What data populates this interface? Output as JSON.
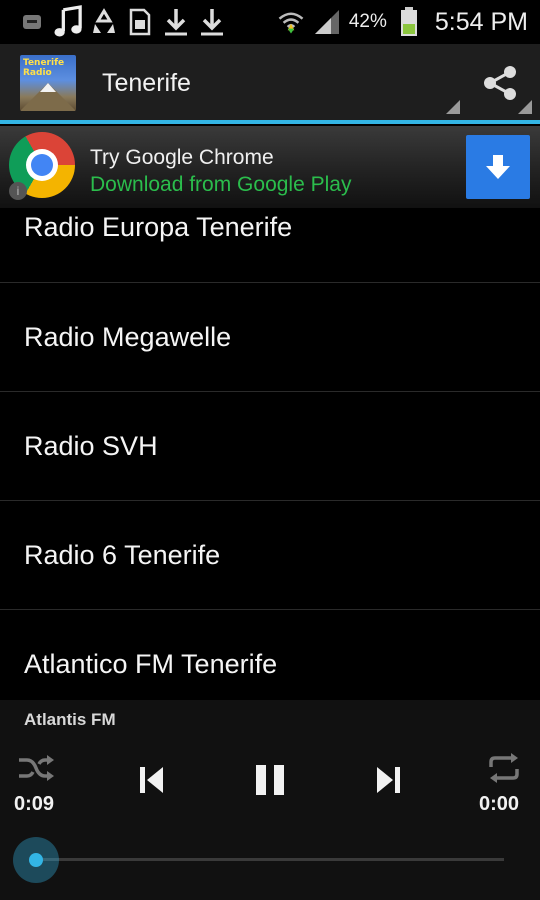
{
  "status_bar": {
    "battery_percent": "42%",
    "time": "5:54 PM",
    "icons": [
      "notification-icon",
      "music-note-icon",
      "recycle-icon",
      "sd-card-icon",
      "download-icon",
      "download-icon",
      "wifi-icon",
      "signal-icon",
      "battery-icon"
    ]
  },
  "action_bar": {
    "app_icon_text": "Tenerife Radio",
    "title": "Tenerife",
    "share_icon": "share-icon"
  },
  "ad": {
    "title": "Try Google Chrome",
    "subtitle": "Download from Google Play",
    "button_icon": "download-arrow-icon"
  },
  "stations": [
    {
      "name": "Radio Europa Tenerife"
    },
    {
      "name": "Radio Megawelle"
    },
    {
      "name": "Radio SVH"
    },
    {
      "name": "Radio 6 Tenerife"
    },
    {
      "name": "Atlantico FM Tenerife"
    }
  ],
  "player": {
    "now_playing": "Atlantis FM",
    "elapsed": "0:09",
    "duration": "0:00",
    "shuffle_icon": "shuffle-icon",
    "prev_icon": "skip-previous-icon",
    "pause_icon": "pause-icon",
    "next_icon": "skip-next-icon",
    "repeat_icon": "repeat-icon",
    "progress_fraction": 0.0
  },
  "colors": {
    "accent": "#33b5e5",
    "ad_green": "#2bbd4c",
    "ad_button": "#2a7be4"
  }
}
